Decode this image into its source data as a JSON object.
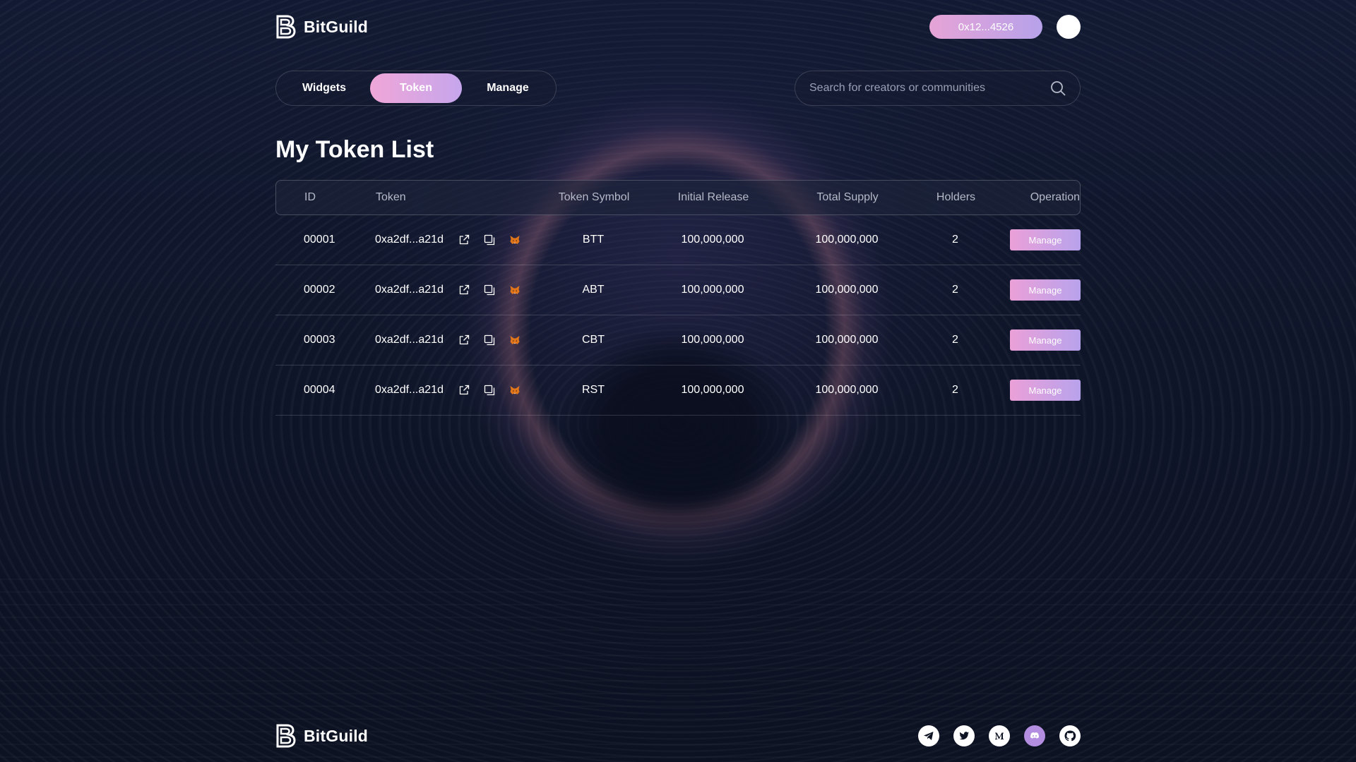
{
  "brand": {
    "name": "BitGuild"
  },
  "header": {
    "wallet_label": "0x12...4526"
  },
  "tabs": [
    {
      "label": "Widgets",
      "active": false
    },
    {
      "label": "Token",
      "active": true
    },
    {
      "label": "Manage",
      "active": false
    }
  ],
  "search": {
    "placeholder": "Search for creators or communities",
    "value": ""
  },
  "page": {
    "title": "My Token List"
  },
  "table": {
    "columns": [
      "ID",
      "Token",
      "Token Symbol",
      "Initial Release",
      "Total Supply",
      "Holders",
      "Operation"
    ],
    "rows": [
      {
        "id": "00001",
        "token": "0xa2df...a21d",
        "symbol": "BTT",
        "initial_release": "100,000,000",
        "total_supply": "100,000,000",
        "holders": "2",
        "action": "Manage"
      },
      {
        "id": "00002",
        "token": "0xa2df...a21d",
        "symbol": "ABT",
        "initial_release": "100,000,000",
        "total_supply": "100,000,000",
        "holders": "2",
        "action": "Manage"
      },
      {
        "id": "00003",
        "token": "0xa2df...a21d",
        "symbol": "CBT",
        "initial_release": "100,000,000",
        "total_supply": "100,000,000",
        "holders": "2",
        "action": "Manage"
      },
      {
        "id": "00004",
        "token": "0xa2df...a21d",
        "symbol": "RST",
        "initial_release": "100,000,000",
        "total_supply": "100,000,000",
        "holders": "2",
        "action": "Manage"
      }
    ],
    "row_icons": [
      "external-link-icon",
      "copy-icon",
      "metamask-fox-icon"
    ]
  },
  "footer": {
    "socials": [
      "telegram-icon",
      "twitter-icon",
      "medium-icon",
      "discord-icon",
      "github-icon"
    ]
  },
  "colors": {
    "accent_gradient_start": "#eba0d8",
    "accent_gradient_end": "#b8a2ec",
    "background": "#0e1324",
    "discord": "#b38ee0"
  }
}
